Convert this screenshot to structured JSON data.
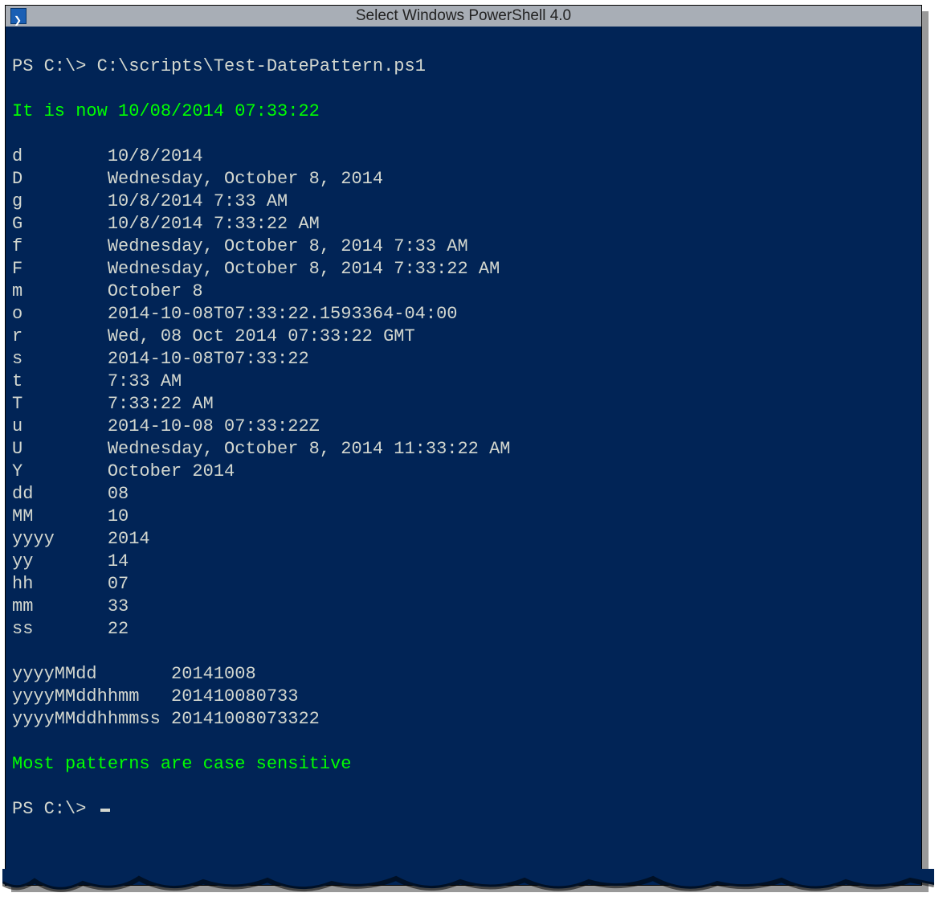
{
  "titlebar": {
    "title": "Select Windows PowerShell 4.0"
  },
  "prompt": {
    "ps": "PS C:\\>",
    "command": "C:\\scripts\\Test-DatePattern.ps1"
  },
  "now_line": "It is now 10/08/2014 07:33:22",
  "patterns": [
    {
      "k": "d",
      "v": "10/8/2014"
    },
    {
      "k": "D",
      "v": "Wednesday, October 8, 2014"
    },
    {
      "k": "g",
      "v": "10/8/2014 7:33 AM"
    },
    {
      "k": "G",
      "v": "10/8/2014 7:33:22 AM"
    },
    {
      "k": "f",
      "v": "Wednesday, October 8, 2014 7:33 AM"
    },
    {
      "k": "F",
      "v": "Wednesday, October 8, 2014 7:33:22 AM"
    },
    {
      "k": "m",
      "v": "October 8"
    },
    {
      "k": "o",
      "v": "2014-10-08T07:33:22.1593364-04:00"
    },
    {
      "k": "r",
      "v": "Wed, 08 Oct 2014 07:33:22 GMT"
    },
    {
      "k": "s",
      "v": "2014-10-08T07:33:22"
    },
    {
      "k": "t",
      "v": "7:33 AM"
    },
    {
      "k": "T",
      "v": "7:33:22 AM"
    },
    {
      "k": "u",
      "v": "2014-10-08 07:33:22Z"
    },
    {
      "k": "U",
      "v": "Wednesday, October 8, 2014 11:33:22 AM"
    },
    {
      "k": "Y",
      "v": "October 2014"
    },
    {
      "k": "dd",
      "v": "08"
    },
    {
      "k": "MM",
      "v": "10"
    },
    {
      "k": "yyyy",
      "v": "2014"
    },
    {
      "k": "yy",
      "v": "14"
    },
    {
      "k": "hh",
      "v": "07"
    },
    {
      "k": "mm",
      "v": "33"
    },
    {
      "k": "ss",
      "v": "22"
    }
  ],
  "patterns_wide": [
    {
      "k": "yyyyMMdd",
      "v": "20141008"
    },
    {
      "k": "yyyyMMddhhmm",
      "v": "201410080733"
    },
    {
      "k": "yyyyMMddhhmmss",
      "v": "20141008073322"
    }
  ],
  "footer_msg": "Most patterns are case sensitive"
}
